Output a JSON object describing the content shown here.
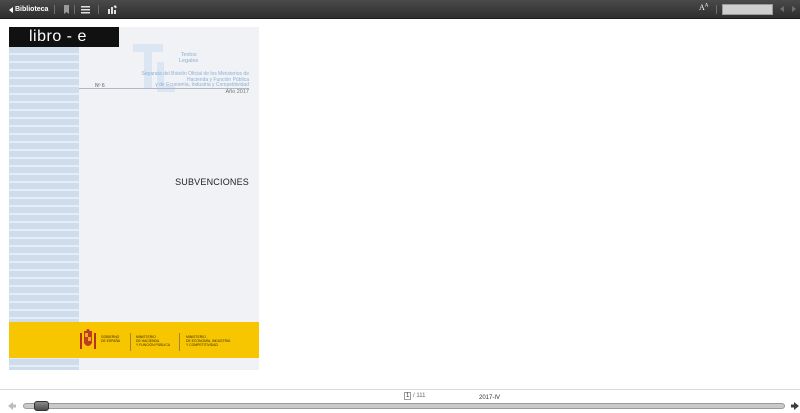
{
  "toolbar": {
    "back_label": "Biblioteca",
    "font_size_label": "A",
    "font_size_sup": "A",
    "search_value": ""
  },
  "cover": {
    "logo": "libro - e",
    "collection_line1": "Textos",
    "collection_line2": "Legales",
    "subtitle_line1": "Separata del Boletín Oficial de los Ministerios de",
    "subtitle_line2": "Hacienda y Función Pública",
    "subtitle_line3": "y de Economía, Industria y Competitividad",
    "number": "Nº 6",
    "year": "Año 2017",
    "title": "SUBVENCIONES",
    "footer": {
      "gov_line1": "GOBIERNO",
      "gov_line2": "DE ESPAÑA",
      "min1_line1": "MINISTERIO",
      "min1_line2": "DE HACIENDA",
      "min1_line3": "Y FUNCIÓN PÚBLICA",
      "min2_line1": "MINISTERIO",
      "min2_line2": "DE ECONOMÍA, INDUSTRIA",
      "min2_line3": "Y COMPETITIVIDAD"
    }
  },
  "bottom": {
    "current_page": "1",
    "total_pages": "/ 111",
    "chapter": "2017-IV",
    "progress": 0.01
  },
  "colors": {
    "toolbar": "#3a3a3a",
    "stripe": "#cfdceb",
    "accent_blue": "#8fb0d4",
    "footer_yellow": "#f7c600"
  }
}
